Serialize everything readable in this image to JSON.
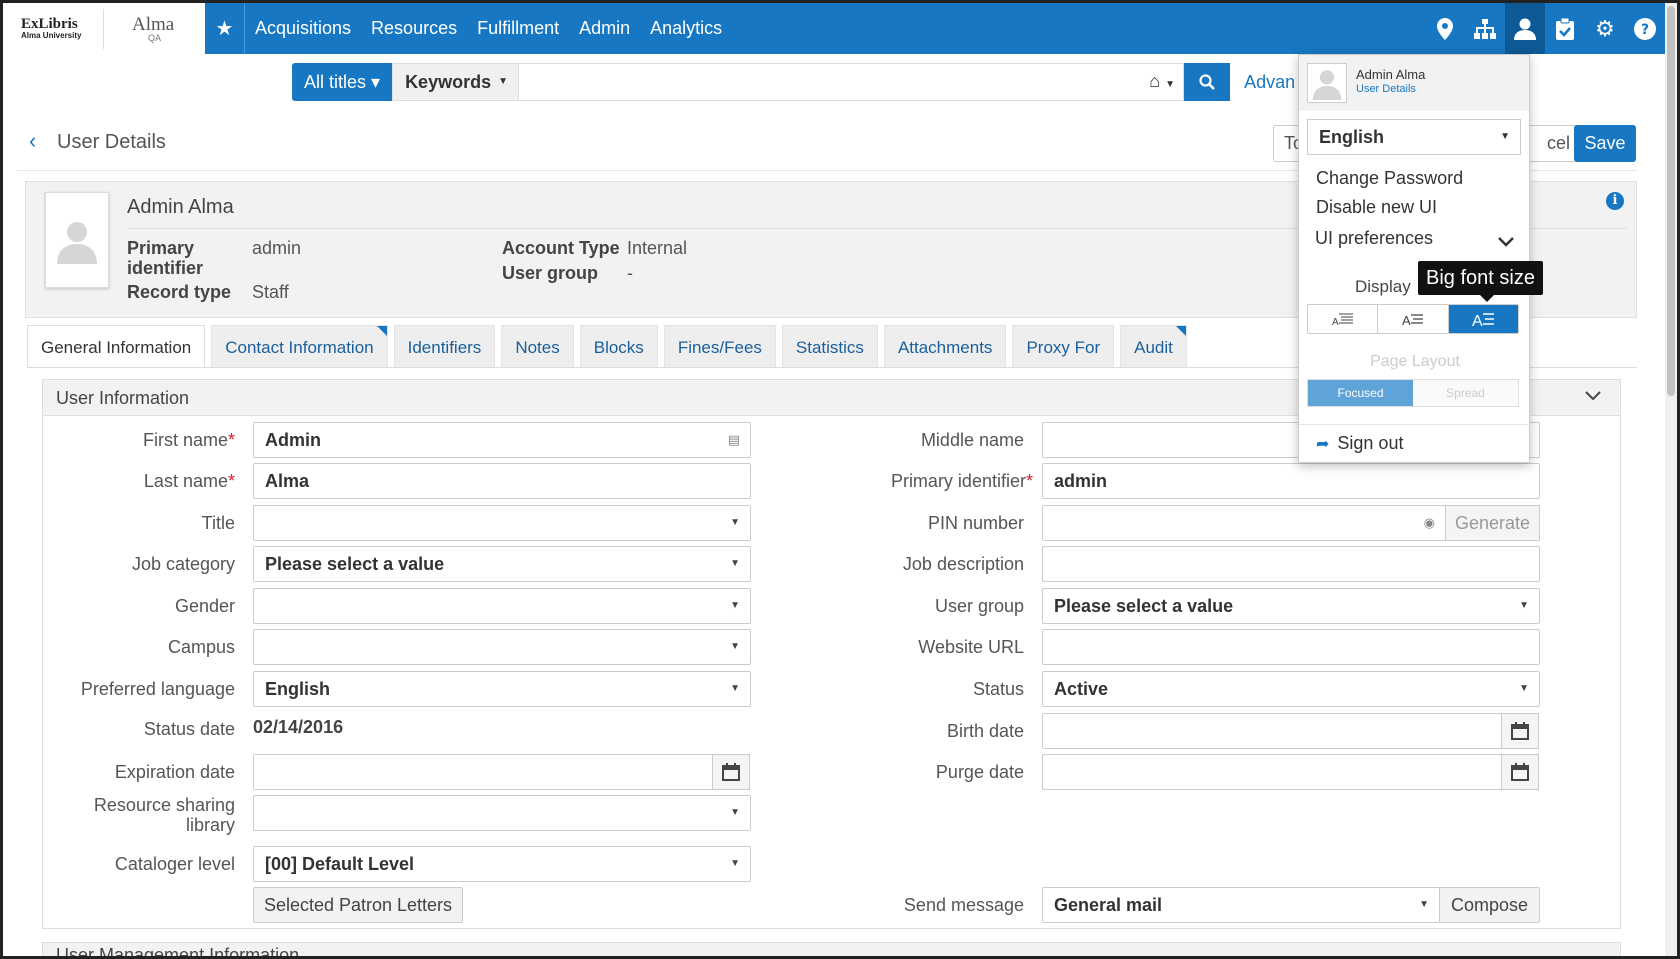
{
  "topbar": {
    "logo_exlibris": "ExLibris",
    "logo_university": "Alma University",
    "logo_alma": "Alma",
    "logo_env": "QA",
    "nav": [
      "Acquisitions",
      "Resources",
      "Fulfillment",
      "Admin",
      "Analytics"
    ]
  },
  "search": {
    "type_label": "All titles ▾",
    "field_label": "Keywords",
    "advanced": "Advan"
  },
  "header": {
    "title": "User Details",
    "btn_to": "To",
    "btn_cancel": "cel",
    "btn_save": "Save"
  },
  "user_card": {
    "name": "Admin Alma",
    "primary_id_label_1": "Primary",
    "primary_id_label_2": "identifier",
    "primary_id_value": "admin",
    "record_type_label": "Record type",
    "record_type_value": "Staff",
    "account_type_label": "Account Type",
    "account_type_value": "Internal",
    "user_group_label": "User group",
    "user_group_value": "-"
  },
  "tabs": [
    "General Information",
    "Contact Information",
    "Identifiers",
    "Notes",
    "Blocks",
    "Fines/Fees",
    "Statistics",
    "Attachments",
    "Proxy For",
    "Audit"
  ],
  "section": {
    "title": "User Information",
    "next_title": "User Management Information"
  },
  "form": {
    "first_name_label": "First name",
    "first_name_value": "Admin",
    "last_name_label": "Last name",
    "last_name_value": "Alma",
    "title_label": "Title",
    "title_value": "",
    "job_category_label": "Job category",
    "job_category_value": "Please select a value",
    "gender_label": "Gender",
    "gender_value": "",
    "campus_label": "Campus",
    "campus_value": "",
    "pref_lang_label": "Preferred language",
    "pref_lang_value": "English",
    "status_date_label": "Status date",
    "status_date_value": "02/14/2016",
    "expiration_label": "Expiration date",
    "expiration_value": "",
    "rs_library_label_1": "Resource sharing",
    "rs_library_label_2": "library",
    "rs_library_value": "",
    "cataloger_label": "Cataloger level",
    "cataloger_value": "[00] Default Level",
    "patron_letters_btn": "Selected Patron Letters",
    "middle_name_label": "Middle name",
    "middle_name_value": "",
    "primary_id_label": "Primary identifier",
    "primary_id_value": "admin",
    "pin_label": "PIN number",
    "pin_value": "",
    "generate_btn": "Generate",
    "job_desc_label": "Job description",
    "job_desc_value": "",
    "user_group_label": "User group",
    "user_group_value": "Please select a value",
    "website_label": "Website URL",
    "website_value": "",
    "status_label": "Status",
    "status_value": "Active",
    "birth_label": "Birth date",
    "birth_value": "",
    "purge_label": "Purge date",
    "purge_value": "",
    "send_msg_label": "Send message",
    "send_msg_value": "General mail",
    "compose_btn": "Compose"
  },
  "user_menu": {
    "name": "Admin Alma",
    "details_link": "User Details",
    "language": "English",
    "change_password": "Change Password",
    "disable_ui": "Disable new UI",
    "ui_prefs": "UI preferences",
    "display": "Display",
    "page_layout": "Page Layout",
    "focused": "Focused",
    "spread": "Spread",
    "sign_out": "Sign out",
    "font_size_selected": "big"
  },
  "tooltip": "Big font size",
  "colors": {
    "brand": "#1777c2",
    "required": "#d9232e"
  }
}
